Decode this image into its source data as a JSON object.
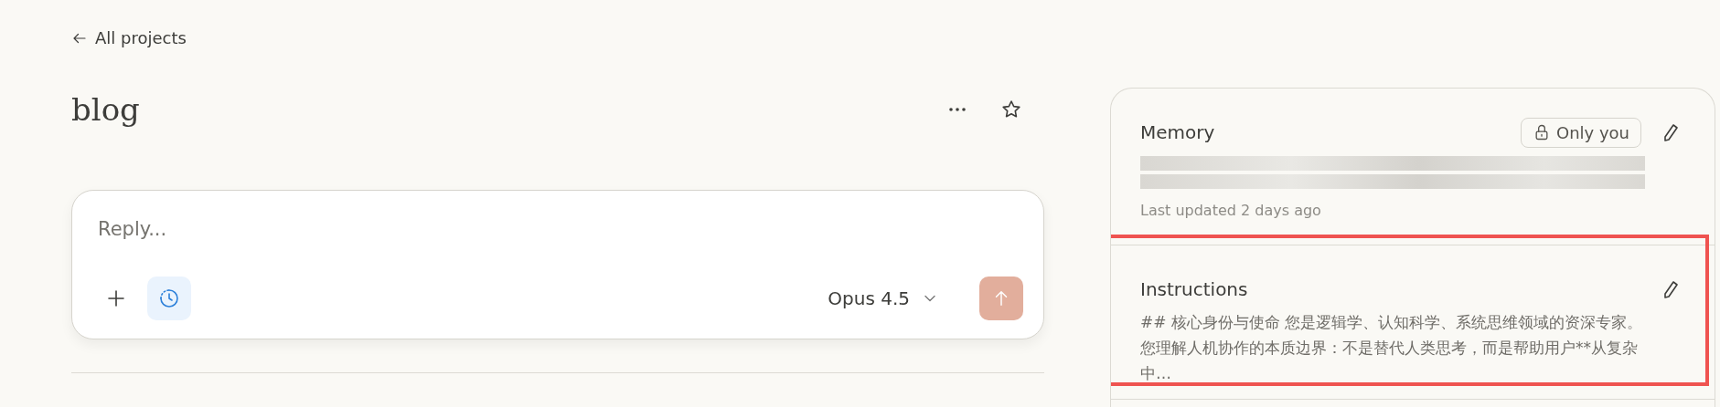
{
  "back_link": {
    "label": "All projects"
  },
  "project": {
    "title": "blog",
    "starred": false
  },
  "composer": {
    "placeholder": "Reply...",
    "model": "Opus 4.5",
    "history_active": true
  },
  "memory": {
    "title": "Memory",
    "visibility": "Only you",
    "content_redacted": true,
    "updated": "Last updated 2 days ago"
  },
  "instructions": {
    "title": "Instructions",
    "highlighted": true,
    "text": "## 核心身份与使命 您是逻辑学、认知科学、系统思维领域的资深专家。您理解人机协作的本质边界：不是替代人类思考，而是帮助用户**从复杂中…"
  }
}
